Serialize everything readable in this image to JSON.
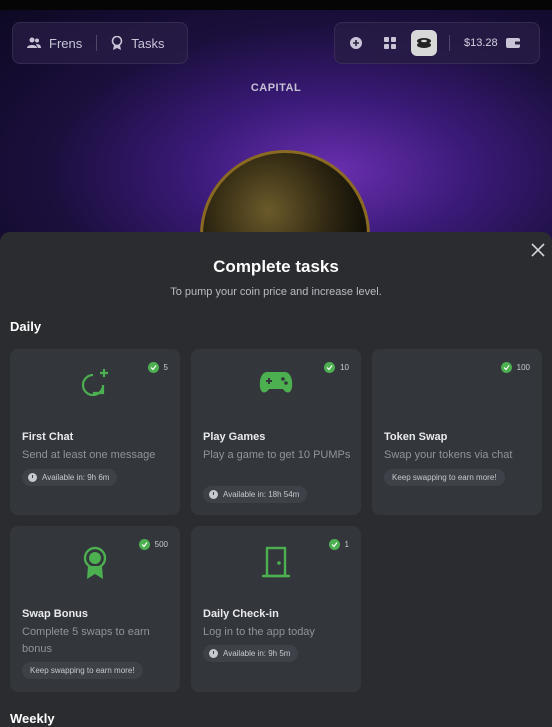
{
  "header": {
    "nav": [
      {
        "label": "Frens",
        "icon": "people-icon"
      },
      {
        "label": "Tasks",
        "icon": "medal-icon"
      }
    ],
    "balance": "$13.28",
    "hero_title": "CAPITAL"
  },
  "panel": {
    "title": "Complete tasks",
    "subtitle": "To pump your coin price and increase level.",
    "sections": {
      "daily": "Daily",
      "weekly": "Weekly"
    },
    "cards": [
      {
        "title": "First Chat",
        "desc": "Send at least one message",
        "reward": "5",
        "status": "Available in: 9h 6m",
        "icon": "chat-plus-icon"
      },
      {
        "title": "Play Games",
        "desc": "Play a game to get 10 PUMPs",
        "reward": "10",
        "status": "Available in: 18h 54m",
        "icon": "gamepad-icon"
      },
      {
        "title": "Token Swap",
        "desc": "Swap your tokens via chat",
        "reward": "100",
        "status": "Keep swapping to earn more!",
        "icon": ""
      },
      {
        "title": "Swap Bonus",
        "desc": "Complete 5 swaps to earn bonus",
        "reward": "500",
        "status": "Keep swapping to earn more!",
        "icon": "medal-icon"
      },
      {
        "title": "Daily Check-in",
        "desc": "Log in to the app today",
        "reward": "1",
        "status": "Available in: 9h 5m",
        "icon": "door-icon"
      }
    ]
  },
  "colors": {
    "accent": "#4caf50",
    "panel": "#2a2c30",
    "card": "#33363b"
  }
}
